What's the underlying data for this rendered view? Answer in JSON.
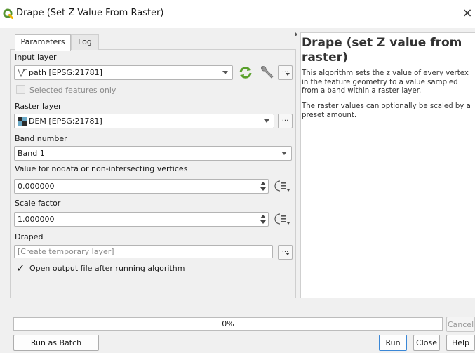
{
  "window": {
    "title": "Drape (Set Z Value From Raster)",
    "close_glyph": "×",
    "logo_icon": "qgis-logo-icon",
    "accent_color": "#589632"
  },
  "tabs": [
    {
      "label": "Parameters",
      "active": true
    },
    {
      "label": "Log",
      "active": false
    }
  ],
  "params": {
    "input_layer_label": "Input layer",
    "input_layer_value": "path [EPSG:21781]",
    "selected_only_label": "Selected features only",
    "raster_layer_label": "Raster layer",
    "raster_layer_value": "DEM [EPSG:21781]",
    "band_label": "Band number",
    "band_value": "Band 1",
    "nodata_label": "Value for nodata or non-intersecting vertices",
    "nodata_value": "0.000000",
    "scale_label": "Scale factor",
    "scale_value": "1.000000",
    "output_label": "Draped",
    "output_placeholder": "[Create temporary layer]",
    "open_output_label": "Open output file after running algorithm",
    "open_output_checked": true,
    "ellipsis": "..."
  },
  "help": {
    "title": "Drape (set Z value from raster)",
    "paragraph1": "This algorithm sets the z value of every vertex in the feature geometry to a value sampled from a band within a raster layer.",
    "paragraph2": "The raster values can optionally be scaled by a preset amount."
  },
  "progress": {
    "value": 0,
    "text": "0%"
  },
  "buttons": {
    "cancel": "Cancel",
    "batch": "Run as Batch Process...",
    "run": "Run",
    "close": "Close",
    "help": "Help"
  }
}
